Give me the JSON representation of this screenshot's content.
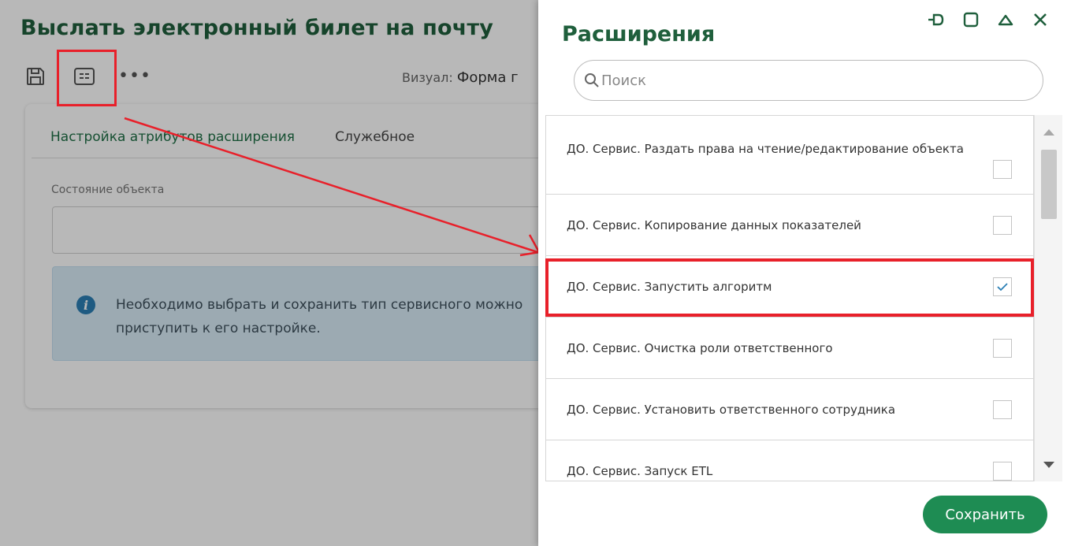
{
  "background": {
    "title": "Выслать электронный билет на почту",
    "toolbar": {
      "save_icon": "floppy-disk-icon",
      "form_icon": "form-view-icon",
      "more_label": "•••",
      "visual_label": "Визуал:",
      "visual_value": "Форма г"
    },
    "tabs": [
      {
        "label": "Настройка атрибутов расширения",
        "active": true
      },
      {
        "label": "Служебное",
        "active": false
      }
    ],
    "state_label": "Состояние объекта",
    "info_text": "Необходимо выбрать и сохранить тип сервисного можно приступить к его настройке."
  },
  "panel": {
    "title": "Расширения",
    "window_controls": [
      "pin-icon",
      "maximize-icon",
      "collapse-icon",
      "close-icon"
    ],
    "search": {
      "placeholder": "Поиск",
      "value": ""
    },
    "items": [
      {
        "label": "ДО. Сервис. Раздать права на чтение/редактирование объекта",
        "checked": false
      },
      {
        "label": "ДО. Сервис. Копирование данных показателей",
        "checked": false
      },
      {
        "label": "ДО. Сервис. Запустить алгоритм",
        "checked": true
      },
      {
        "label": "ДО. Сервис. Очистка роли ответственного",
        "checked": false
      },
      {
        "label": "ДО. Сервис. Установить ответственного сотрудника",
        "checked": false
      },
      {
        "label": "ДО. Сервис. Запуск ETL",
        "checked": false
      }
    ],
    "save_label": "Сохранить"
  },
  "colors": {
    "accent_green": "#1e8c53",
    "title_green": "#1f5f3c",
    "highlight_red": "#e8202a",
    "info_blue": "#d9ecf7"
  }
}
